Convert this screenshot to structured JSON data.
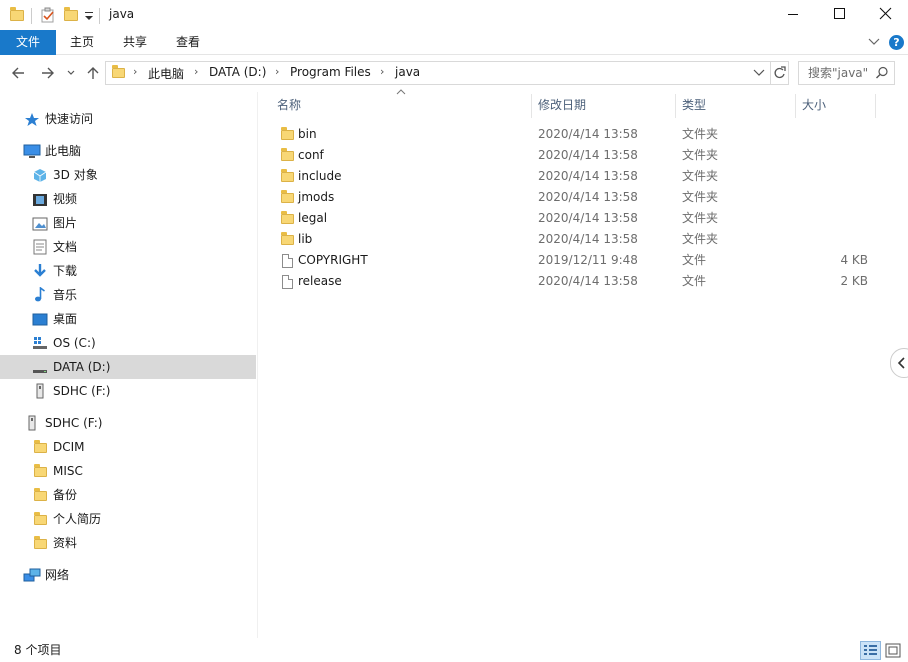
{
  "window": {
    "title": "java"
  },
  "ribbon": {
    "tabs": [
      "文件",
      "主页",
      "共享",
      "查看"
    ],
    "help_glyph": "?"
  },
  "address": {
    "crumbs": [
      "此电脑",
      "DATA (D:)",
      "Program Files",
      "java"
    ],
    "search_placeholder": "搜索\"java\""
  },
  "columns": {
    "name": "名称",
    "modified": "修改日期",
    "type": "类型",
    "size": "大小"
  },
  "files": [
    {
      "name": "bin",
      "modified": "2020/4/14 13:58",
      "type": "文件夹",
      "size": "",
      "kind": "folder"
    },
    {
      "name": "conf",
      "modified": "2020/4/14 13:58",
      "type": "文件夹",
      "size": "",
      "kind": "folder"
    },
    {
      "name": "include",
      "modified": "2020/4/14 13:58",
      "type": "文件夹",
      "size": "",
      "kind": "folder"
    },
    {
      "name": "jmods",
      "modified": "2020/4/14 13:58",
      "type": "文件夹",
      "size": "",
      "kind": "folder"
    },
    {
      "name": "legal",
      "modified": "2020/4/14 13:58",
      "type": "文件夹",
      "size": "",
      "kind": "folder"
    },
    {
      "name": "lib",
      "modified": "2020/4/14 13:58",
      "type": "文件夹",
      "size": "",
      "kind": "folder"
    },
    {
      "name": "COPYRIGHT",
      "modified": "2019/12/11 9:48",
      "type": "文件",
      "size": "4 KB",
      "kind": "file"
    },
    {
      "name": "release",
      "modified": "2020/4/14 13:58",
      "type": "文件",
      "size": "2 KB",
      "kind": "file"
    }
  ],
  "sidebar": {
    "quick_access": "快速访问",
    "this_pc": "此电脑",
    "pc_items": [
      "3D 对象",
      "视频",
      "图片",
      "文档",
      "下载",
      "音乐",
      "桌面",
      "OS (C:)",
      "DATA (D:)",
      "SDHC (F:)"
    ],
    "sdhc": "SDHC (F:)",
    "sdhc_items": [
      "DCIM",
      "MISC",
      "备份",
      "个人简历",
      "资料"
    ],
    "network": "网络"
  },
  "status": {
    "item_count": "8 个项目"
  },
  "colors": {
    "file_tab": "#1979ca",
    "folder": "#f8d775",
    "selected": "#d9d9d9"
  }
}
